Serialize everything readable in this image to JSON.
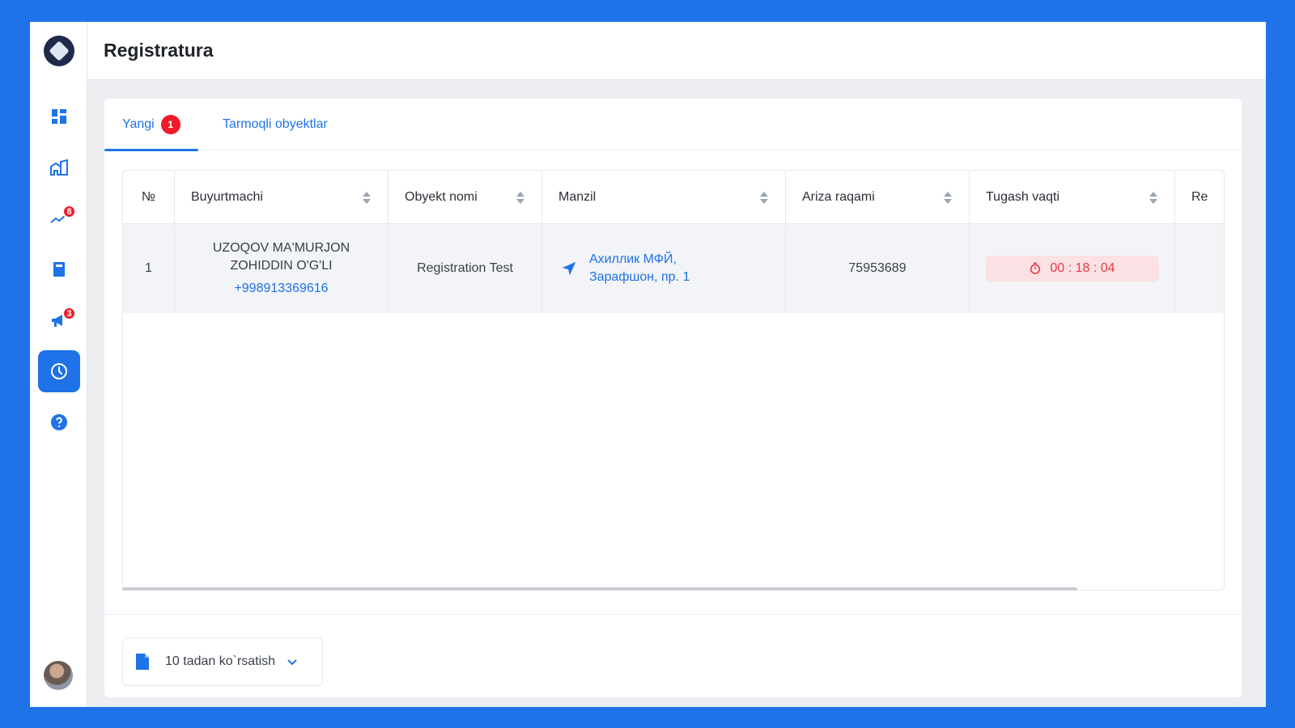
{
  "header": {
    "title": "Registratura"
  },
  "sidebar": {
    "items": [
      {
        "icon": "dashboard-icon",
        "badge": ""
      },
      {
        "icon": "buildings-icon",
        "badge": ""
      },
      {
        "icon": "chart-trend-icon",
        "badge": "8"
      },
      {
        "icon": "book-icon",
        "badge": ""
      },
      {
        "icon": "megaphone-icon",
        "badge": "3"
      },
      {
        "icon": "clock-icon",
        "badge": "",
        "active": true
      },
      {
        "icon": "help-icon",
        "badge": ""
      }
    ]
  },
  "tabs": [
    {
      "label": "Yangi",
      "badge": "1",
      "active": true
    },
    {
      "label": "Tarmoqli obyektlar"
    }
  ],
  "table": {
    "columns": [
      "№",
      "Buyurtmachi",
      "Obyekt nomi",
      "Manzil",
      "Ariza raqami",
      "Tugash vaqti",
      "Re"
    ],
    "rows": [
      {
        "num": "1",
        "customer_line1": "UZOQOV MA'MURJON",
        "customer_line2": "ZOHIDDIN O'G'LI",
        "phone": "+998913369616",
        "object_name": "Registration Test",
        "address_line1": "Ахиллик МФЙ,",
        "address_line2": "Зарафшон, пр. 1",
        "application_number": "75953689",
        "time_left": "00 : 18 : 04"
      }
    ]
  },
  "footer": {
    "page_size_label": "10 tadan ko`rsatish"
  },
  "colors": {
    "accent": "#1f72e8",
    "badge": "#ee1c2a",
    "timer_bg": "#fbe1e3",
    "timer_text": "#e53945"
  }
}
